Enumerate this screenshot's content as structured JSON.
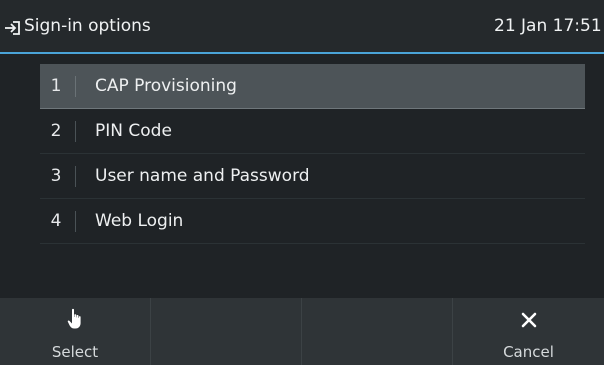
{
  "header": {
    "title": "Sign-in options",
    "datetime": "21 Jan 17:51",
    "back_icon": "sign-in-arrow-icon"
  },
  "list": {
    "selected_index": 0,
    "items": [
      {
        "number": "1",
        "label": "CAP Provisioning"
      },
      {
        "number": "2",
        "label": "PIN Code"
      },
      {
        "number": "3",
        "label": "User name and Password"
      },
      {
        "number": "4",
        "label": "Web Login"
      }
    ]
  },
  "softkeys": {
    "keys": [
      {
        "label": "Select",
        "icon": "hand-pointer-icon"
      },
      {
        "label": "",
        "icon": ""
      },
      {
        "label": "",
        "icon": ""
      },
      {
        "label": "Cancel",
        "icon": "close-icon"
      }
    ]
  },
  "colors": {
    "accent": "#4aa4d8",
    "background": "#1f2326",
    "selected_row": "#4d5458",
    "softkey_bar": "#2f3437"
  }
}
